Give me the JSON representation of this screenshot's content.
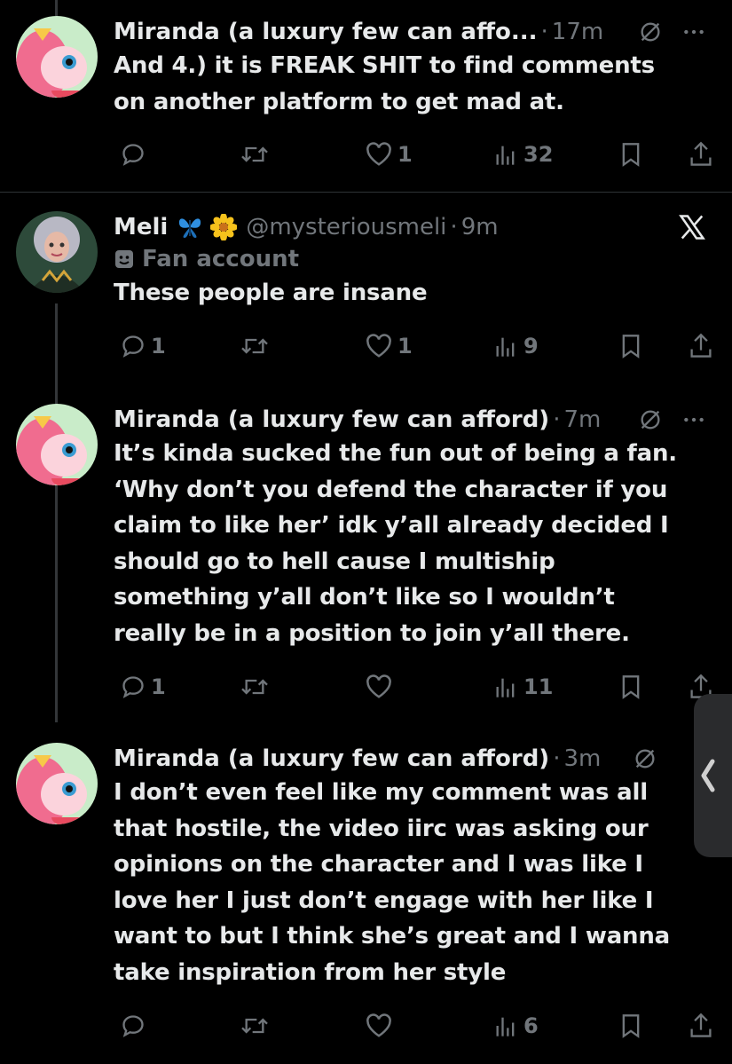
{
  "tweets": [
    {
      "name": "Miranda (a luxury few can affo...",
      "time": "17m",
      "text": [
        "And 4.) it is FREAK SHIT to find comments",
        "on another platform to get mad at."
      ],
      "replies": "",
      "retweets": "",
      "likes": "1",
      "views": "32"
    },
    {
      "name": "Meli",
      "handle": "@mysteriousmeli",
      "time": "9m",
      "badge": "Fan account",
      "text": [
        "These people are insane"
      ],
      "replies": "1",
      "retweets": "",
      "likes": "1",
      "views": "9"
    },
    {
      "name": "Miranda (a luxury few can afford)",
      "time": "7m",
      "text": [
        "It’s kinda sucked the fun out of being a fan.",
        "‘Why don’t you defend the character if you",
        "claim to like her’ idk y’all already decided I",
        "should go to hell cause I multiship",
        "something y’all don’t like so I wouldn’t",
        "really be in a position to join y’all there."
      ],
      "replies": "1",
      "retweets": "",
      "likes": "",
      "views": "11"
    },
    {
      "name": "Miranda (a luxury few can afford)",
      "time": "3m",
      "text": [
        "I don’t even feel like my comment was all",
        "that hostile, the video iirc was asking our",
        "opinions on the character and I was like I",
        "love her I just don’t engage with her like I",
        "want to but I think she’s great and I wanna",
        "take inspiration from her style"
      ],
      "replies": "",
      "retweets": "",
      "likes": "",
      "views": "6"
    }
  ],
  "dot": "·",
  "colors": {
    "background": "#000000",
    "text": "#e7e9ea",
    "secondary": "#71767b",
    "divider": "#2f3336"
  }
}
